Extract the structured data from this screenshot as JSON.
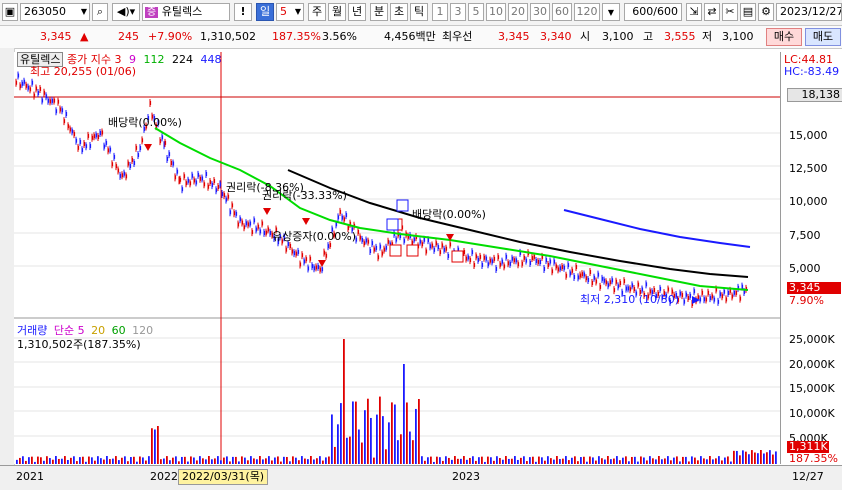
{
  "toolbar": {
    "code": "263050",
    "name": "유틸렉스",
    "warn_label": "!",
    "period_buttons": [
      "일",
      "5",
      "주",
      "월",
      "년",
      "분",
      "초",
      "틱"
    ],
    "minute_buttons": [
      "1",
      "3",
      "5",
      "10",
      "20",
      "30",
      "60",
      "120"
    ],
    "count": "600",
    "count_total": "600",
    "date": "2023/12/27"
  },
  "quote": {
    "price": "3,345",
    "change": "245",
    "change_pct": "+7.90%",
    "volume": "1,310,502",
    "vol_ratio": "187.35%",
    "turnover": "3.56%",
    "amount": "4,456백만",
    "ask_label": "최우선",
    "ask": "3,345",
    "bid": "3,340",
    "open_label": "시",
    "open": "3,100",
    "high_label": "고",
    "high": "3,555",
    "low_label": "저",
    "low": "3,100",
    "buy_button": "매수",
    "sell_button": "매도"
  },
  "price_panel": {
    "stock_label": "유틸렉스",
    "legend_prefix": "종가 지수",
    "ma": [
      {
        "label": "3",
        "color": "#e00000"
      },
      {
        "label": "9",
        "color": "#cc00cc"
      },
      {
        "label": "112",
        "color": "#00b000"
      },
      {
        "label": "224",
        "color": "#000000"
      },
      {
        "label": "448",
        "color": "#1a1aff"
      }
    ],
    "high_note": "최고 20,255 (01/06)",
    "low_note": "최저 2,310 (10/30)",
    "div_note1": "배당락(0.00%)",
    "rights_note1": "권리락(-8.36%)",
    "rights_note2": "권리락(-33.33%)",
    "bonus_note": "유상증자(0.00%)",
    "div_note2": "배당락(0.00%)",
    "lc": "LC:44.81",
    "hc": "HC:-83.49",
    "y_ticks": [
      "15,000",
      "12,500",
      "10,000",
      "7,500",
      "5,000"
    ],
    "ref_price": "18,138",
    "last_price": "3,345",
    "last_pct": "7.90%"
  },
  "volume_panel": {
    "label": "거래량",
    "ma_prefix": "단순",
    "ma": [
      {
        "label": "5",
        "color": "#cc00cc"
      },
      {
        "label": "20",
        "color": "#c8a000"
      },
      {
        "label": "60",
        "color": "#00a000"
      },
      {
        "label": "120",
        "color": "#999999"
      }
    ],
    "summary": "1,310,502주(187.35%)",
    "y_ticks": [
      "25,000K",
      "20,000K",
      "15,000K",
      "10,000K",
      "5,000K"
    ],
    "last_volume": "1,311K",
    "last_pct": "187.35%"
  },
  "xaxis": {
    "labels": [
      "2021",
      "2022",
      "2023"
    ],
    "cursor_date": "2022/03/31(목)",
    "right_date": "12/27"
  },
  "colors": {
    "up": "#e00000",
    "down": "#1a1aff",
    "ma112": "#00dd00",
    "ma224": "#000000",
    "ma448": "#1a1aff",
    "ref_line": "#cc0000"
  }
}
